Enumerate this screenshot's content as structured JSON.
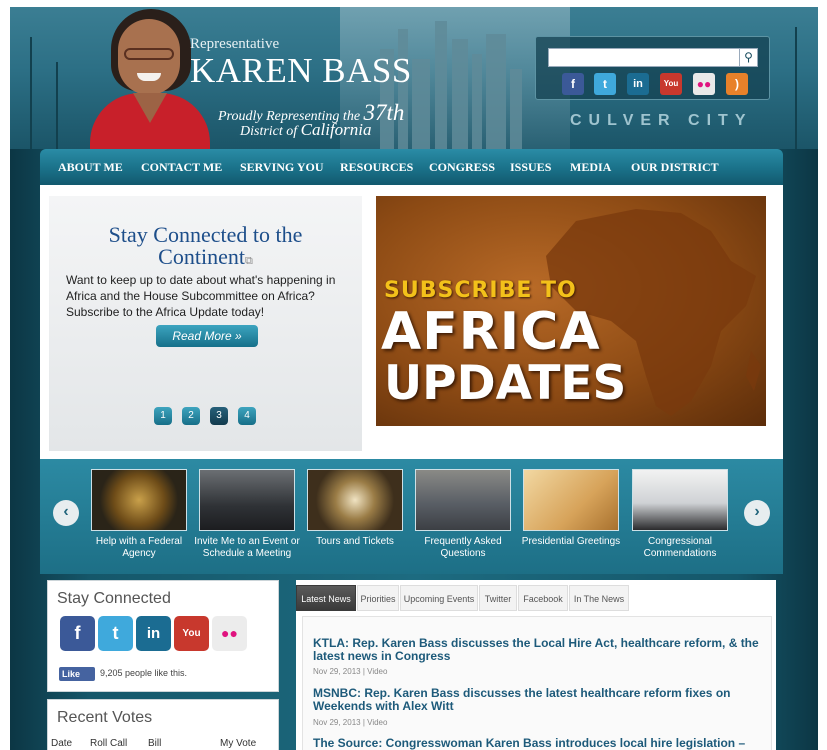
{
  "header": {
    "rep_label": "Representative",
    "name": "KAREN BASS",
    "proudly": "Proudly Representing the",
    "district_number": "37th",
    "district_prefix": "District of",
    "district_state": "California",
    "city_banner": "CULVER CITY",
    "search": {
      "value": "",
      "placeholder": ""
    },
    "social_icons": [
      "facebook-icon",
      "twitter-icon",
      "linkedin-icon",
      "youtube-icon",
      "flickr-icon",
      "rss-icon"
    ]
  },
  "nav": [
    "ABOUT ME",
    "CONTACT ME",
    "SERVING YOU",
    "RESOURCES",
    "CONGRESS",
    "ISSUES",
    "MEDIA",
    "OUR DISTRICT"
  ],
  "hero": {
    "title_line1": "Stay Connected to the",
    "title_line2": "Continent",
    "body": "Want to keep up to date about what's happening in Africa and the House Subcommittee on Africa? Subscribe to the Africa Update today!",
    "read_more": "Read More »",
    "pages": [
      "1",
      "2",
      "3",
      "4"
    ],
    "active_page": "3",
    "banner_line1": "SUBSCRIBE TO",
    "banner_line2": "AFRICA",
    "banner_line3": "UPDATES"
  },
  "carousel": {
    "items": [
      {
        "caption": "Help with a Federal Agency"
      },
      {
        "caption": "Invite Me to an Event or Schedule a Meeting"
      },
      {
        "caption": "Tours and Tickets"
      },
      {
        "caption": "Frequently Asked Questions"
      },
      {
        "caption": "Presidential Greetings"
      },
      {
        "caption": "Congressional Commendations"
      }
    ],
    "prev": "‹",
    "next": "›"
  },
  "stay_connected": {
    "title": "Stay Connected",
    "like_label": "Like",
    "like_count": "9,205 people like this."
  },
  "recent_votes": {
    "title": "Recent Votes",
    "columns": [
      "Date",
      "Roll Call",
      "Bill",
      "My Vote"
    ]
  },
  "news": {
    "tabs": [
      "Latest News",
      "Priorities",
      "Upcoming Events",
      "Twitter",
      "Facebook",
      "In The News"
    ],
    "items": [
      {
        "headline": "KTLA: Rep. Karen Bass discusses the Local Hire Act, healthcare reform, & the latest news in Congress",
        "date": "Nov 29, 2013",
        "category": "Video"
      },
      {
        "headline": "MSNBC: Rep. Karen Bass discusses the latest healthcare reform fixes on Weekends with Alex Witt",
        "date": "Nov 29, 2013",
        "category": "Video"
      },
      {
        "headline": "The Source: Congresswoman Karen Bass introduces local hire legislation – bill is consistent with America Fast Forward legislation",
        "date": "",
        "category": ""
      }
    ]
  },
  "colors": {
    "accent": "#1d7189",
    "nav_dark": "#12596e",
    "link": "#1d5a7a",
    "title_blue": "#1d4e8a"
  }
}
